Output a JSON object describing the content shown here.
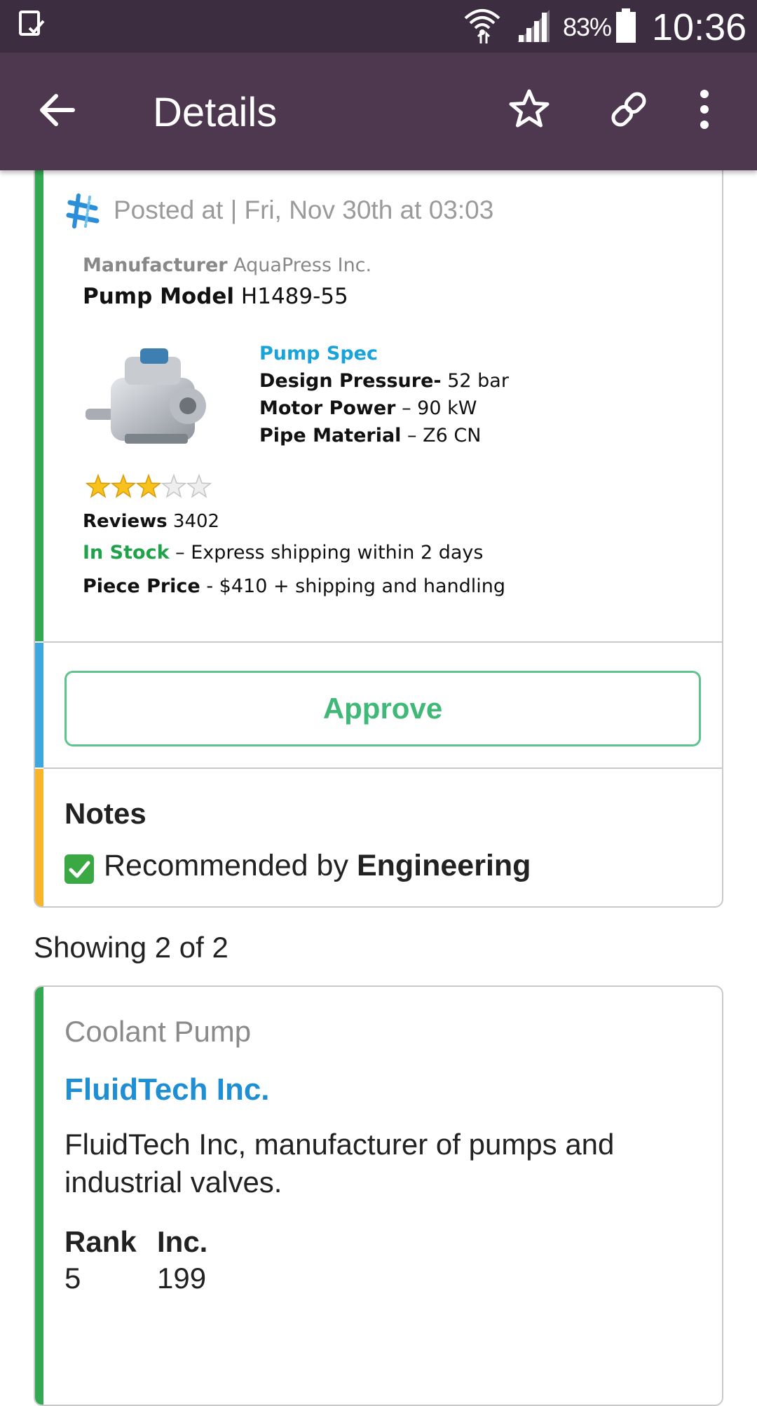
{
  "status_bar": {
    "battery": "83%",
    "time": "10:36"
  },
  "app_bar": {
    "title": "Details",
    "icons": [
      "arrow-back-icon",
      "star-outline-icon",
      "link-icon",
      "more-vert-icon"
    ]
  },
  "post": {
    "posted_at": "Posted at | Fri, Nov 30th at 03:03",
    "manufacturer_label": "Manufacturer",
    "manufacturer": "AquaPress Inc.",
    "model_label": "Pump Model",
    "model": "H1489-55",
    "spec_title": "Pump Spec",
    "specs": [
      {
        "label": "Design Pressure-",
        "value": " 52 bar"
      },
      {
        "label": "Motor Power",
        "value": " – 90 kW"
      },
      {
        "label": "Pipe Material",
        "value": " – Z6 CN"
      }
    ],
    "rating": 3,
    "rating_max": 5,
    "reviews_label": "Reviews",
    "reviews": "3402",
    "stock_status": "In Stock",
    "stock_detail": " – Express shipping within 2 days",
    "price_label": "Piece Price",
    "price_detail": " - $410 + shipping and handling"
  },
  "actions": {
    "approve_label": "Approve"
  },
  "notes": {
    "title": "Notes",
    "text": "Recommended by",
    "team": "Engineering"
  },
  "list": {
    "showing": "Showing 2 of 2"
  },
  "result_card": {
    "category": "Coolant Pump",
    "company": "FluidTech Inc.",
    "description": "FluidTech Inc, manufacturer of pumps and industrial valves.",
    "rank_label": "Rank",
    "rank": "5",
    "inc_label": "Inc.",
    "inc": "199"
  },
  "colors": {
    "status_bar": "#3d2d40",
    "app_bar": "#4d384f",
    "stripe_green": "#35a853",
    "stripe_blue": "#3ea7e0",
    "stripe_yellow": "#f8b42b",
    "approve": "#3fb878",
    "link_blue": "#1e8fd4"
  }
}
